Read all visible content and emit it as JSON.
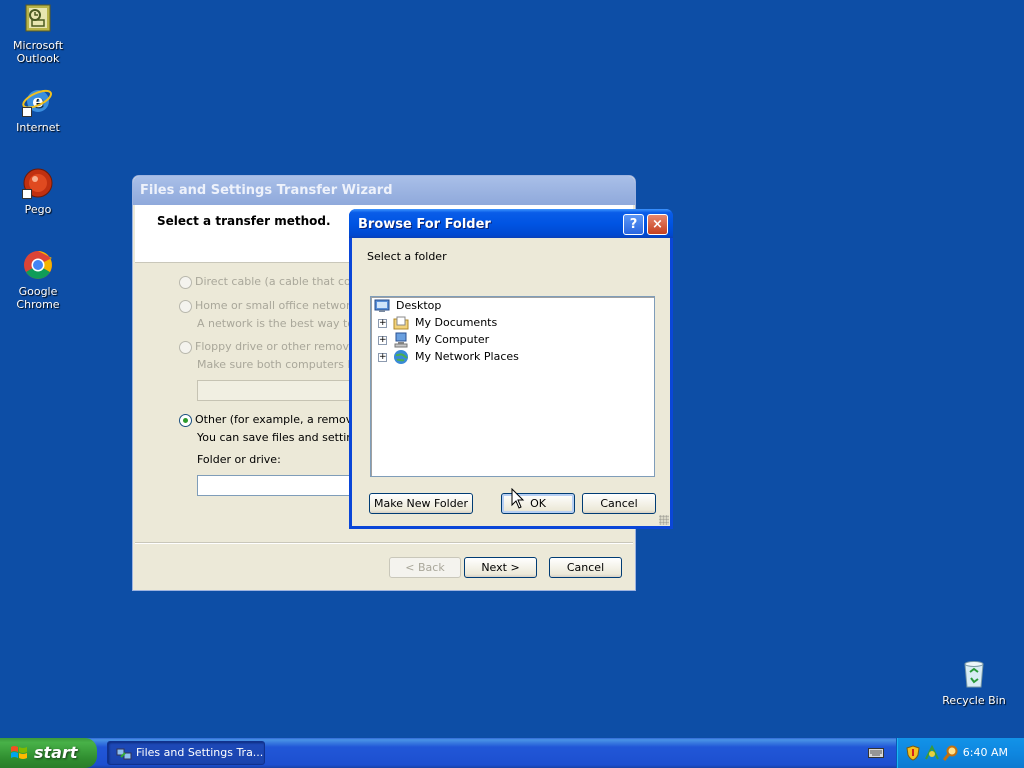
{
  "desktop": {
    "icons": [
      {
        "label": "Microsoft Outlook"
      },
      {
        "label": "Internet"
      },
      {
        "label": "Pego"
      },
      {
        "label": "Google Chrome"
      },
      {
        "label": "Recycle Bin"
      }
    ]
  },
  "wizard": {
    "title": "Files and Settings Transfer Wizard",
    "header_title": "Select a transfer method.",
    "options": [
      {
        "label": "Direct cable (a cable that connec",
        "selected": false
      },
      {
        "label": "Home or small office network",
        "desc": "A network is the best way to tran",
        "selected": false
      },
      {
        "label": "Floppy drive or other removable m",
        "desc": "Make sure both computers have",
        "selected": false
      },
      {
        "label": "Other (for example, a removable d",
        "desc": "You can save files and settings t",
        "selected": true
      }
    ],
    "folder_label": "Folder or drive:",
    "folder_value": "",
    "buttons": {
      "back": "< Back",
      "next": "Next >",
      "cancel": "Cancel"
    }
  },
  "browse_dialog": {
    "title": "Browse For Folder",
    "help_label": "?",
    "close_label": "×",
    "prompt": "Select a folder",
    "tree": {
      "root": "Desktop",
      "items": [
        {
          "label": "My Documents",
          "selected": true
        },
        {
          "label": "My Computer",
          "selected": false
        },
        {
          "label": "My Network Places",
          "selected": false
        }
      ],
      "expander": "+"
    },
    "buttons": {
      "new_folder": "Make New Folder",
      "ok": "OK",
      "cancel": "Cancel"
    }
  },
  "taskbar": {
    "start_label": "start",
    "tasks": [
      {
        "label": "Files and Settings Tra..."
      }
    ],
    "clock": "6:40 AM"
  },
  "colors": {
    "desktop": "#0d4ea6",
    "xp_blue_title": "#0054e3",
    "start_green": "#48b148",
    "tray_blue": "#0f87e0"
  }
}
